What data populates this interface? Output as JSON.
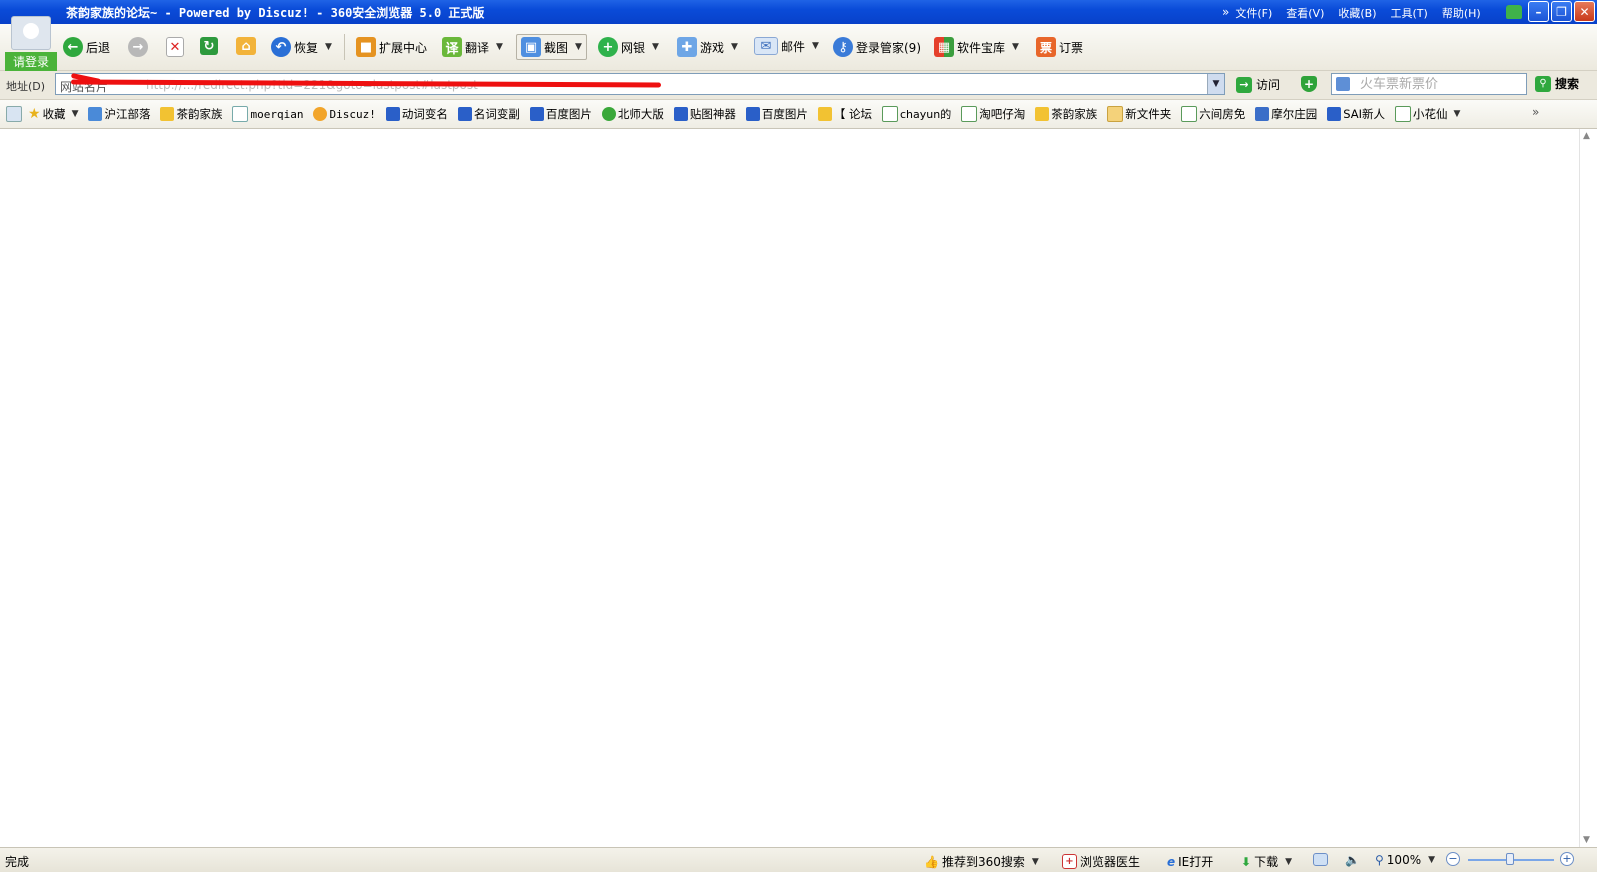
{
  "window": {
    "title": "茶韵家族的论坛~ - Powered by Discuz! - 360安全浏览器 5.0 正式版",
    "menu": [
      "文件(F)",
      "查看(V)",
      "收藏(B)",
      "工具(T)",
      "帮助(H)"
    ],
    "controls": {
      "minimize": "–",
      "restore": "❐",
      "close": "✕"
    }
  },
  "toolbar": {
    "login_label": "请登录",
    "back": "后退",
    "restore": "恢复",
    "extensions": "扩展中心",
    "translate": "翻译",
    "translate_icon": "译",
    "screenshot": "截图",
    "netbank": "网银",
    "games": "游戏",
    "mail": "邮件",
    "login_manager": "登录管家(9)",
    "software": "软件宝库",
    "tickets": "订票",
    "tickets_icon": "票"
  },
  "address": {
    "label": "地址(D)",
    "prefix": "网站名片",
    "url": "http://.../redirect.php?tid=221&goto=lastpost#lastpost",
    "visit": "访问",
    "search_placeholder": "火车票新票价",
    "search_button": "搜索"
  },
  "favorites": {
    "collect": "收藏",
    "items": [
      "沪江部落",
      "茶韵家族",
      "moerqian",
      "Discuz!",
      "动词变名",
      "名词变副",
      "百度图片",
      "北师大版",
      "贴图神器",
      "百度图片",
      "【 论坛",
      "chayun的",
      "淘吧仔淘",
      "茶韵家族",
      "新文件夹",
      "六间房免",
      "摩尔庄园",
      "SAI新人",
      "小花仙"
    ],
    "more": "»"
  },
  "status": {
    "text": "完成",
    "recommend": "推荐到360搜索",
    "doctor": "浏览器医生",
    "ie_open": "IE打开",
    "download": "下载",
    "zoom": "100%"
  }
}
